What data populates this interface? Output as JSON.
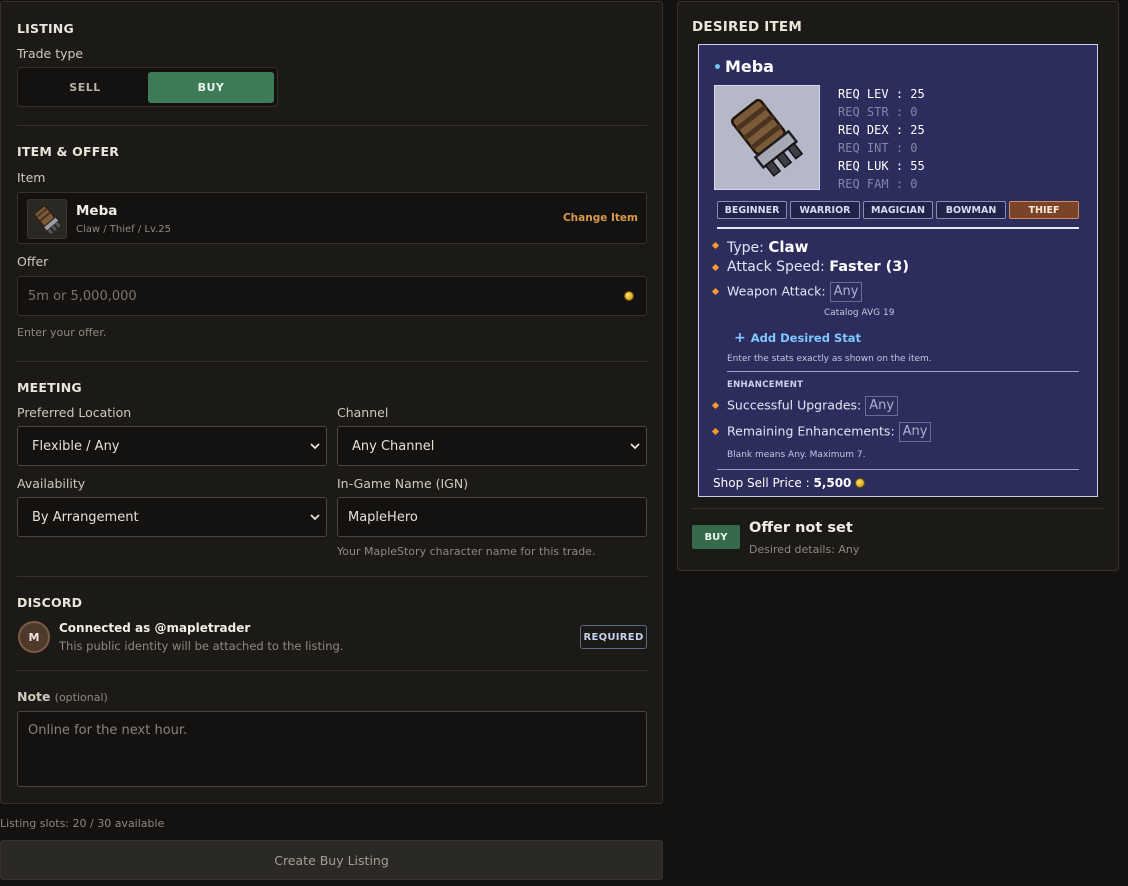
{
  "listing": {
    "title": "LISTING",
    "trade_type_label": "Trade type",
    "sell": "SELL",
    "buy": "BUY"
  },
  "item_offer": {
    "title": "ITEM & OFFER",
    "item_label": "Item",
    "item_name": "Meba",
    "item_meta": "Claw / Thief / Lv.25",
    "change_item": "Change Item",
    "offer_label": "Offer",
    "offer_placeholder": "5m or 5,000,000",
    "offer_help": "Enter your offer."
  },
  "meeting": {
    "title": "MEETING",
    "location_label": "Preferred Location",
    "location_value": "Flexible / Any",
    "channel_label": "Channel",
    "channel_value": "Any Channel",
    "availability_label": "Availability",
    "availability_value": "By Arrangement",
    "ign_label": "In-Game Name (IGN)",
    "ign_value": "MapleHero",
    "ign_help": "Your MapleStory character name for this trade."
  },
  "discord": {
    "title": "DISCORD",
    "avatar_initial": "M",
    "connected": "Connected as @mapletrader",
    "help": "This public identity will be attached to the listing.",
    "badge": "REQUIRED"
  },
  "note": {
    "label": "Note",
    "optional": "(optional)",
    "placeholder": "Online for the next hour."
  },
  "footer": {
    "slots": "Listing slots: 20 / 30 available",
    "create_button": "Create Buy Listing"
  },
  "desired": {
    "title": "DESIRED ITEM",
    "name": "Meba",
    "reqs": [
      {
        "label": "REQ LEV",
        "value": ": 25",
        "active": true
      },
      {
        "label": "REQ STR",
        "value": ": 0",
        "active": false
      },
      {
        "label": "REQ DEX",
        "value": ": 25",
        "active": true
      },
      {
        "label": "REQ INT",
        "value": ": 0",
        "active": false
      },
      {
        "label": "REQ LUK",
        "value": ": 55",
        "active": true
      },
      {
        "label": "REQ FAM",
        "value": ": 0",
        "active": false
      }
    ],
    "jobs": [
      "BEGINNER",
      "WARRIOR",
      "MAGICIAN",
      "BOWMAN",
      "THIEF"
    ],
    "active_job": "THIEF",
    "type_label": "Type:",
    "type_value": "Claw",
    "speed_label": "Attack Speed:",
    "speed_value": "Faster (3)",
    "weapon_attack_label": "Weapon Attack:",
    "any": "Any",
    "catalog_avg": "Catalog AVG 19",
    "add_stat": "Add Desired Stat",
    "stats_help": "Enter the stats exactly as shown on the item.",
    "enhancement_title": "ENHANCEMENT",
    "upgrades_label": "Successful Upgrades:",
    "remaining_label": "Remaining Enhancements:",
    "enh_help": "Blank means Any. Maximum 7.",
    "shop_price_label": "Shop Sell Price :",
    "shop_price_value": "5,500"
  },
  "summary": {
    "badge": "BUY",
    "status": "Offer not set",
    "details": "Desired details: Any"
  },
  "colors": {
    "accent_green": "#3d7a56",
    "accent_orange": "#d89a4a",
    "card_bg": "#2c2d5c",
    "active_job": "#7a4428"
  }
}
